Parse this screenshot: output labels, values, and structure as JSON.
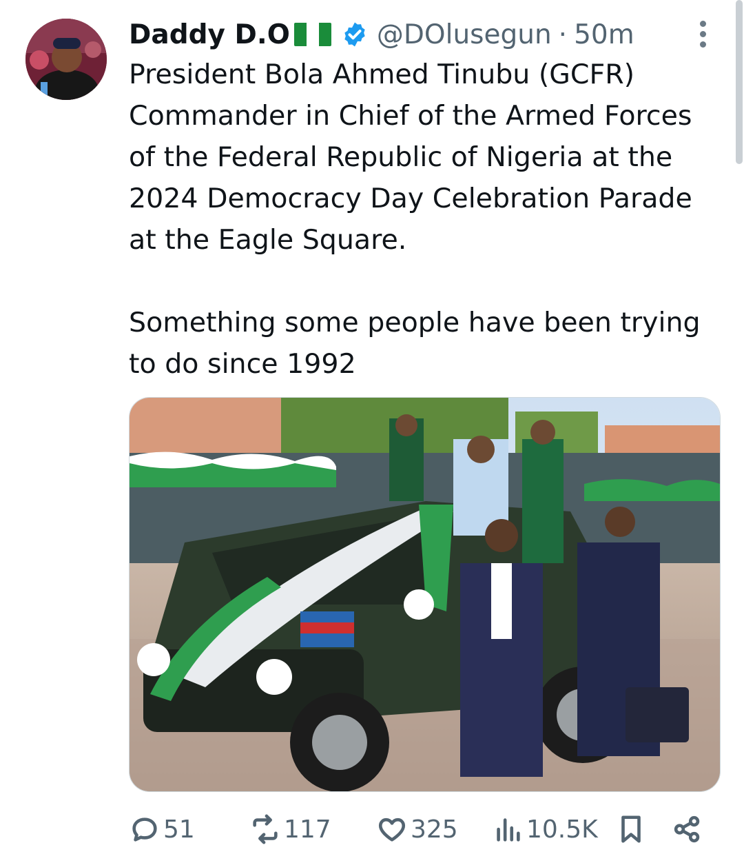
{
  "tweet": {
    "author_name": "Daddy D.O",
    "author_flag": "nigeria-flag-emoji",
    "verified": true,
    "handle": "@DOlusegun",
    "separator": "·",
    "time": "50m",
    "text": "President Bola Ahmed Tinubu (GCFR)\nCommander in Chief of the Armed Forces\nof the Federal Republic of Nigeria at the\n2024 Democracy Day Celebration Parade\nat the Eagle Square.\n\nSomething some people have been trying\nto do since 1992",
    "colors": {
      "accent": "#1d9bf0",
      "muted": "#536471",
      "text": "#0f1419"
    }
  },
  "actions": {
    "replies": "51",
    "reposts": "117",
    "likes": "325",
    "views": "10.5K"
  },
  "icons": {
    "reply": "reply-icon",
    "repost": "repost-icon",
    "like": "heart-icon",
    "views": "views-icon",
    "bookmark": "bookmark-icon",
    "share": "share-icon",
    "more": "more-vertical-icon"
  }
}
